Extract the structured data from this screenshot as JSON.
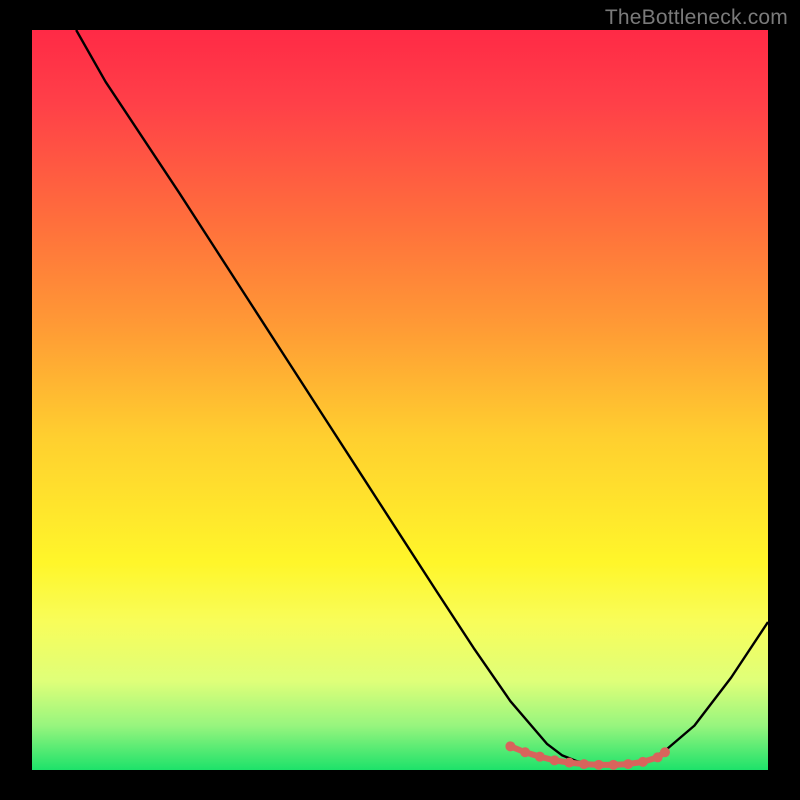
{
  "watermark": "TheBottleneck.com",
  "chart_data": {
    "type": "line",
    "title": "",
    "xlabel": "",
    "ylabel": "",
    "xlim": [
      0,
      100
    ],
    "ylim": [
      0,
      100
    ],
    "grid": false,
    "legend": false,
    "series": [
      {
        "name": "curve",
        "color": "#000000",
        "x": [
          6,
          10,
          15,
          20,
          25,
          30,
          35,
          40,
          45,
          50,
          55,
          60,
          65,
          70,
          72,
          74,
          76,
          78,
          80,
          82,
          84,
          86,
          90,
          95,
          100
        ],
        "y": [
          100,
          93,
          85.5,
          78,
          70.3,
          62.6,
          54.9,
          47.2,
          39.5,
          31.8,
          24.1,
          16.5,
          9.3,
          3.5,
          2.0,
          1.2,
          0.8,
          0.6,
          0.6,
          0.9,
          1.5,
          2.6,
          6.0,
          12.5,
          20.0
        ]
      },
      {
        "name": "highlight",
        "color": "#d8645c",
        "x": [
          65,
          67,
          69,
          71,
          73,
          75,
          77,
          79,
          81,
          83,
          85,
          86
        ],
        "y": [
          3.2,
          2.4,
          1.8,
          1.3,
          1.0,
          0.8,
          0.7,
          0.7,
          0.8,
          1.1,
          1.7,
          2.4
        ]
      }
    ]
  }
}
